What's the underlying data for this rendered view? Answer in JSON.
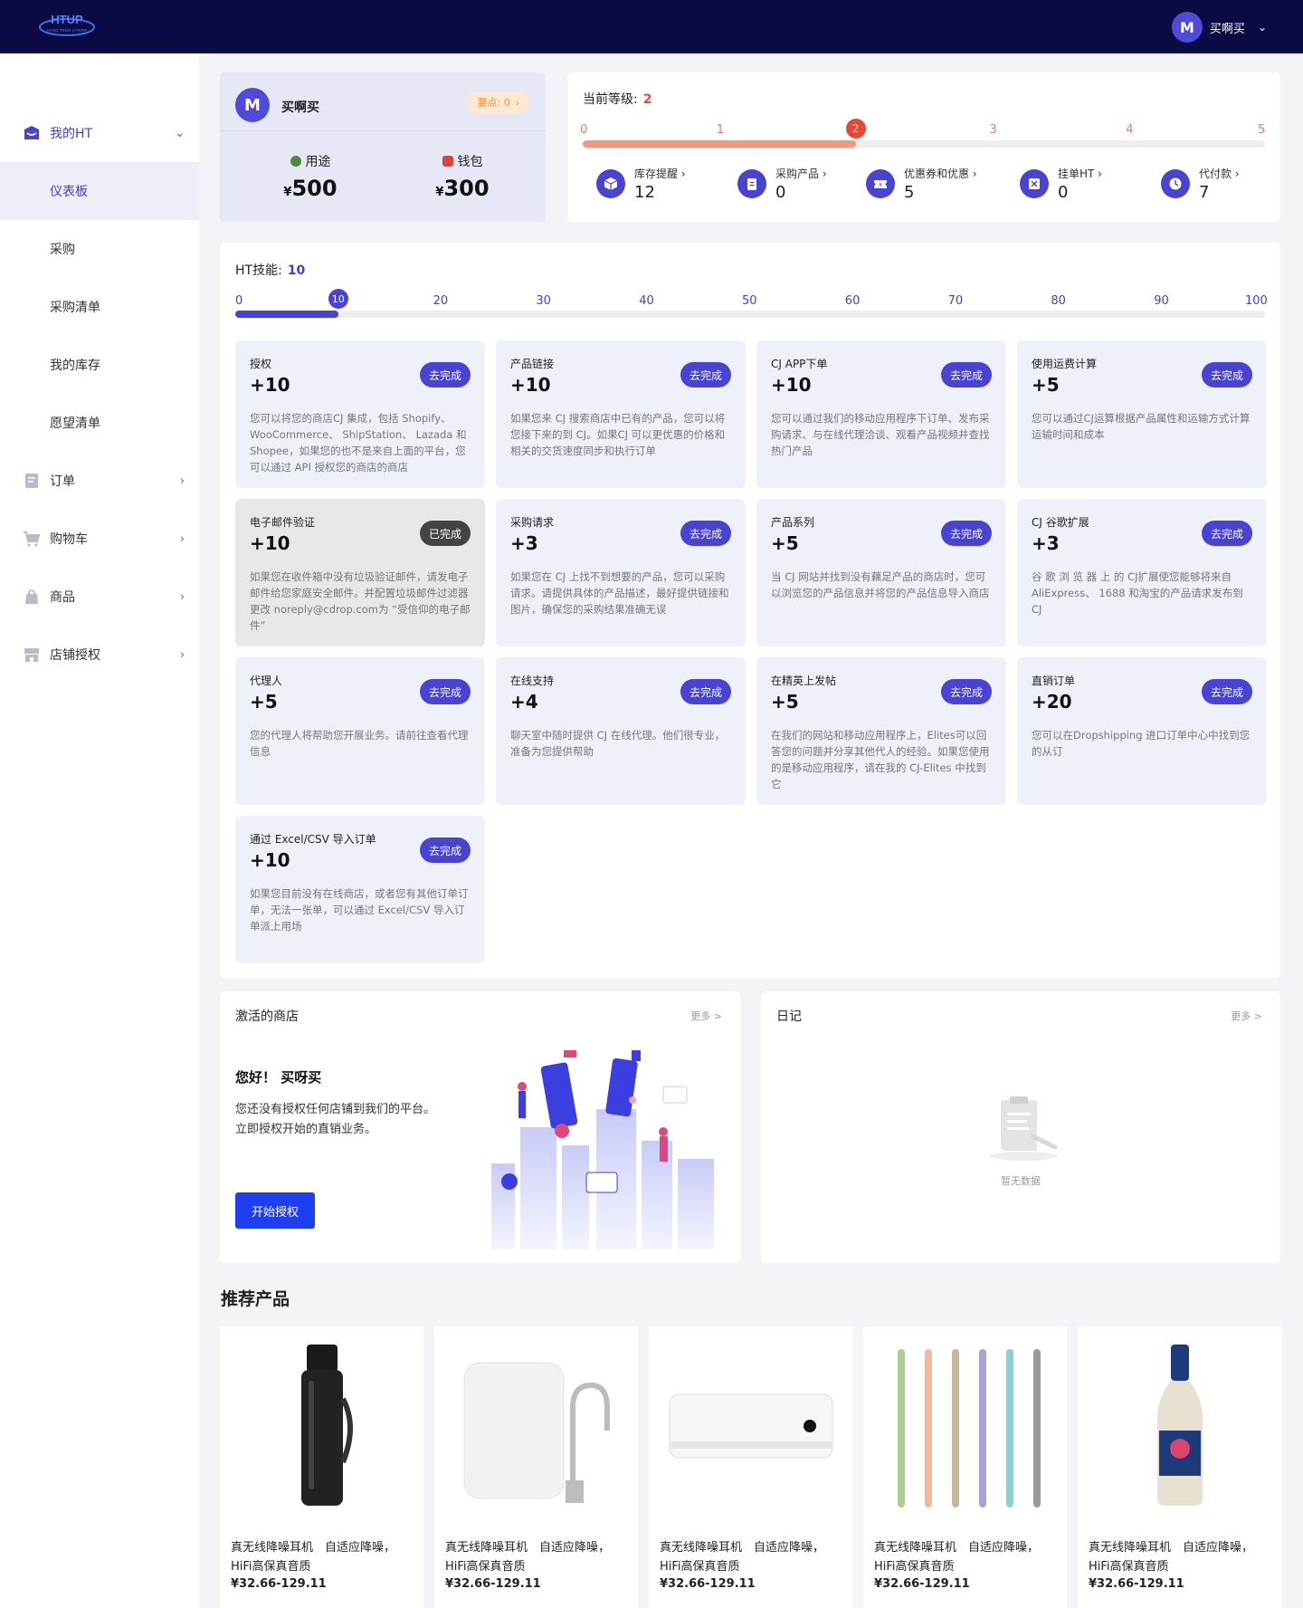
{
  "header": {
    "logo_text": "HTUP",
    "logo_subtext": "HANG TENG U PERP",
    "avatar_letter": "M",
    "username": "买啊买"
  },
  "sidebar": {
    "items": [
      {
        "label": "我的HT",
        "icon": "store-icon"
      },
      {
        "label": "仪表板"
      },
      {
        "label": "采购"
      },
      {
        "label": "采购清单"
      },
      {
        "label": "我的库存"
      },
      {
        "label": "愿望清单"
      },
      {
        "label": "订单",
        "icon": "order-icon"
      },
      {
        "label": "购物车",
        "icon": "cart-icon"
      },
      {
        "label": "商品",
        "icon": "bag-icon"
      },
      {
        "label": "店铺授权",
        "icon": "shop-auth-icon"
      }
    ]
  },
  "user_card": {
    "avatar_letter": "M",
    "name": "买啊买",
    "points_label": "要点: 0",
    "usage_label": "用途",
    "usage_currency": "¥",
    "usage_value": "500",
    "wallet_label": "钱包",
    "wallet_currency": "¥",
    "wallet_value": "300"
  },
  "level": {
    "title": "当前等级:",
    "current": "2",
    "ticks": [
      "0",
      "1",
      "2",
      "3",
      "4",
      "5"
    ],
    "progress": 0.4,
    "stats": [
      {
        "label": "库存提醒",
        "value": "12",
        "icon": "cube-icon"
      },
      {
        "label": "采购产品",
        "value": "0",
        "icon": "clipboard-icon"
      },
      {
        "label": "优惠券和优惠",
        "value": "5",
        "icon": "coupon-icon"
      },
      {
        "label": "挂单HT",
        "value": "0",
        "icon": "pending-icon"
      },
      {
        "label": "代付款",
        "value": "7",
        "icon": "clock-icon"
      }
    ]
  },
  "skills": {
    "title": "HT技能:",
    "current": "10",
    "ticks": [
      "0",
      "10",
      "20",
      "30",
      "40",
      "50",
      "60",
      "70",
      "80",
      "90",
      "100"
    ],
    "progress": 0.1,
    "todo_label": "去完成",
    "done_label": "已完成",
    "tasks": [
      {
        "name": "授权",
        "points": "+10",
        "done": false,
        "desc": "您可以将您的商店CJ 集成，包括 Shopify、WooCommerce、 ShipStation、 Lazada 和 Shopee，如果您的也不是来自上面的平台，您可以通过 API 授权您的商店的商店"
      },
      {
        "name": "产品链接",
        "points": "+10",
        "done": false,
        "desc": "如果您来 CJ 搜索商店中已有的产品，您可以将您接下来的到 CJ。如果CJ 可以更优惠的价格和相关的交货速度同步和执行订单"
      },
      {
        "name": "CJ APP下单",
        "points": "+10",
        "done": false,
        "desc": "您可以通过我们的移动应用程序下订单、发布采购请求、与在线代理洽谈、观看产品视频并查找热门产品"
      },
      {
        "name": "使用运费计算",
        "points": "+5",
        "done": false,
        "desc": "您可以通过CJ运算根据产品属性和运输方式计算运输时间和成本"
      },
      {
        "name": "电子邮件验证",
        "points": "+10",
        "done": true,
        "desc": "如果您在收件箱中没有垃圾验证邮件，请发电子邮件给您家庭安全邮件。并配置垃圾邮件过滤器更改 noreply@cdrop.com为 “受信仰的电子邮件”"
      },
      {
        "name": "采购请求",
        "points": "+3",
        "done": false,
        "desc": "如果您在 CJ 上找不到想要的产品，您可以采购请求。请提供具体的产品描述，最好提供链接和图片，确保您的采购结果准确无误"
      },
      {
        "name": "产品系列",
        "points": "+5",
        "done": false,
        "desc": "当 CJ 网站并找到没有藕足产品的商店时，您可以浏览您的产品信息并将您的产品信息导入商店"
      },
      {
        "name": "CJ 谷歌扩展",
        "points": "+3",
        "done": false,
        "desc": "谷 歌 浏 览 器 上 的 CJ扩展使您能够将来自 AliExpress、 1688 和淘宝的产品请求发布到 CJ"
      },
      {
        "name": "代理人",
        "points": "+5",
        "done": false,
        "desc": "您的代理人将帮助您开展业务。请前往查看代理信息"
      },
      {
        "name": "在线支持",
        "points": "+4",
        "done": false,
        "desc": "聊天室中随时提供 CJ 在线代理。他们很专业，准备为您提供帮助"
      },
      {
        "name": "在精英上发帖",
        "points": "+5",
        "done": false,
        "desc": "在我们的网站和移动应用程序上，Elites可以回答您的问题并分享其他代人的经验。如果您使用的是移动应用程序，请在我的 CJ-Elites 中找到它"
      },
      {
        "name": "直销订单",
        "points": "+20",
        "done": false,
        "desc": "您可以在Dropshipping 进口订单中心中找到您的从订"
      },
      {
        "name": "通过 Excel/CSV 导入订单",
        "points": "+10",
        "done": false,
        "desc": "如果您目前没有在线商店，或者您有其他订单订单，无法一张单，可以通过 Excel/CSV 导入订单派上用场"
      }
    ]
  },
  "store": {
    "title": "激活的商店",
    "more": "更多 >",
    "hello": "您好！ 买呀买",
    "desc_line1": "您还没有授权任何店铺到我们的平台。",
    "desc_line2": "立即授权开始的直销业务。",
    "button": "开始授权"
  },
  "diary": {
    "title": "日记",
    "more": "更多 >",
    "empty": "暂无数据"
  },
  "recommended": {
    "title": "推荐产品",
    "products": [
      {
        "name": "真无线降噪耳机　自适应降噪，HiFi高保真音质",
        "price": "¥32.66-129.11",
        "image": "thermos"
      },
      {
        "name": "真无线降噪耳机　自适应降噪，HiFi高保真音质",
        "price": "¥32.66-129.11",
        "image": "water-purifier"
      },
      {
        "name": "真无线降噪耳机　自适应降噪，HiFi高保真音质",
        "price": "¥32.66-129.11",
        "image": "air-conditioner"
      },
      {
        "name": "真无线降噪耳机　自适应降噪，HiFi高保真音质",
        "price": "¥32.66-129.11",
        "image": "toothbrushes"
      },
      {
        "name": "真无线降噪耳机　自适应降噪，HiFi高保真音质",
        "price": "¥32.66-129.11",
        "image": "beer-bottle"
      }
    ]
  },
  "colors": {
    "topbar": "#0b0a45",
    "primary": "#4744d1",
    "level_accent": "#e6483c",
    "auth_button": "#1e3ff0"
  }
}
